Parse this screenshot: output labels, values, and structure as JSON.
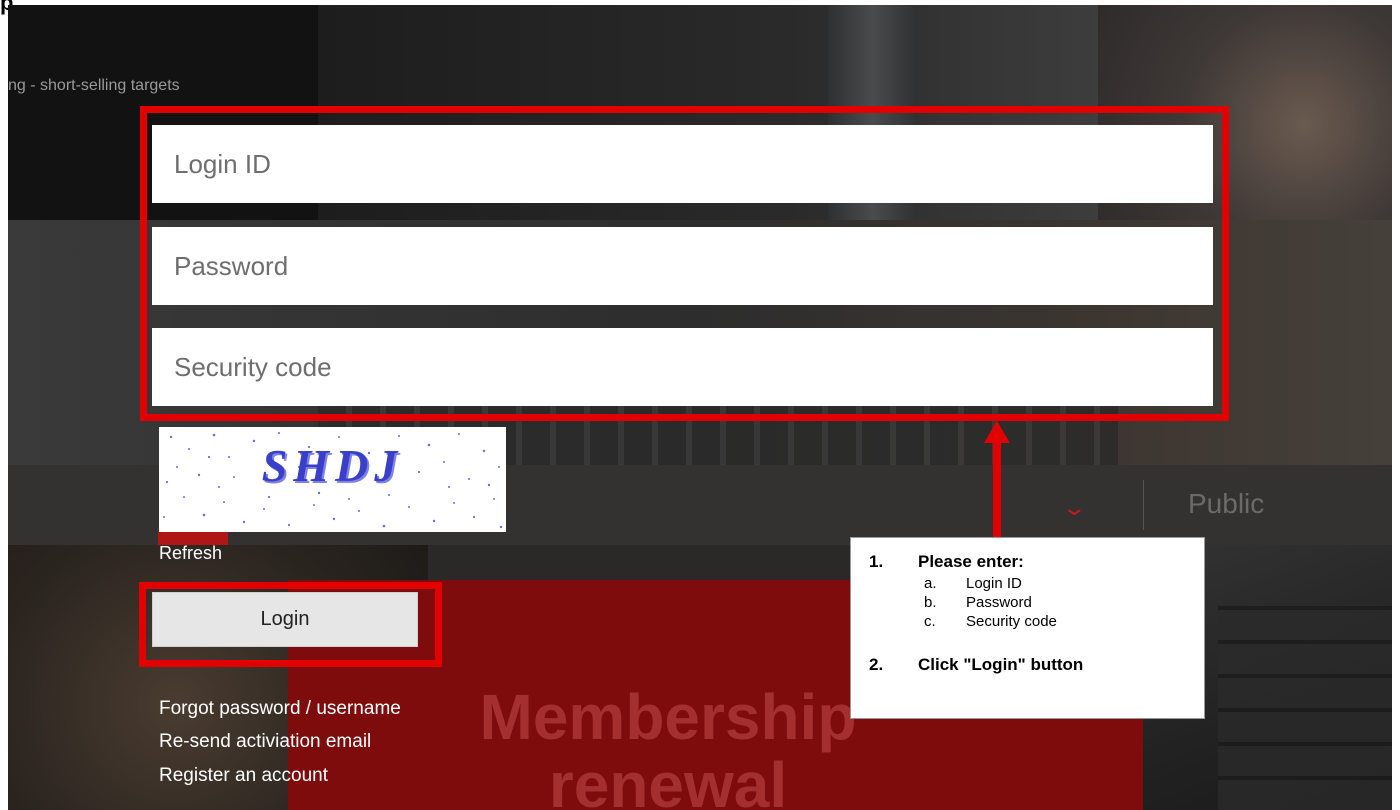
{
  "page": {
    "title": "p"
  },
  "background": {
    "ticker_text": "ng - short-selling targets",
    "nav_label": "Public",
    "nav_chevron_icon": "chevron-down-icon",
    "banner_line1": "Membership",
    "banner_line2": "renewal"
  },
  "form": {
    "login_id_placeholder": "Login ID",
    "password_placeholder": "Password",
    "security_code_placeholder": "Security code",
    "captcha_text": "SHDJ",
    "refresh_label": "Refresh",
    "login_button_label": "Login"
  },
  "links": {
    "forgot": "Forgot password / username",
    "resend": "Re-send activiation email",
    "register": "Register an account"
  },
  "callout": {
    "step1_number": "1.",
    "step1_title": "Please enter:",
    "items": [
      {
        "letter": "a.",
        "text": "Login ID"
      },
      {
        "letter": "b.",
        "text": "Password"
      },
      {
        "letter": "c.",
        "text": "Security code"
      }
    ],
    "step2_number": "2.",
    "step2_title": "Click  \"Login\" button"
  },
  "colors": {
    "annotation_red": "#e30000",
    "banner_red": "#7e0c0c",
    "captcha_blue": "#3a3fc9"
  }
}
